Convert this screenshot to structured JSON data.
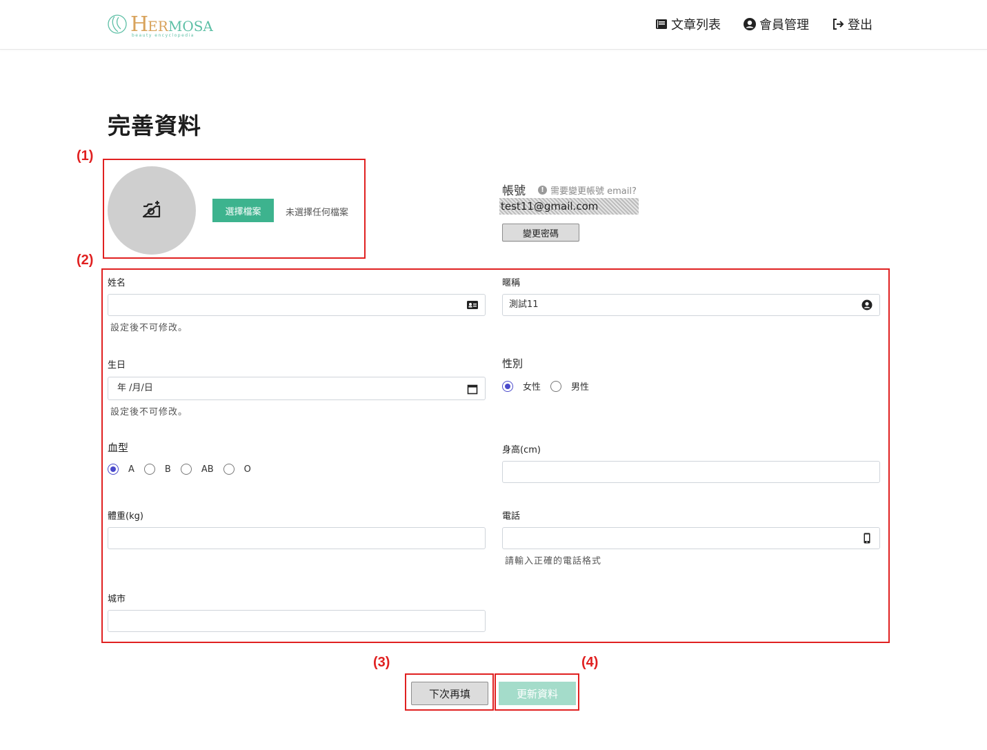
{
  "brand": {
    "logo_h": "H",
    "logo_er": "ER",
    "logo_mosa": "MOSA",
    "logo_sub": "beauty encyclopedia",
    "primary_color": "#3db38e",
    "accent_color": "#d8a35c"
  },
  "nav": {
    "articles": {
      "label": "文章列表",
      "icon": "book-icon"
    },
    "members": {
      "label": "會員管理",
      "icon": "user-circle-icon"
    },
    "logout": {
      "label": "登出",
      "icon": "sign-out-icon"
    }
  },
  "page": {
    "title": "完善資料"
  },
  "annotations": {
    "a1": "(1)",
    "a2": "(2)",
    "a3": "(3)",
    "a4": "(4)"
  },
  "avatar": {
    "icon": "camera-plus-icon",
    "choose_file": "選擇檔案",
    "no_file": "未選擇任何檔案"
  },
  "account": {
    "label": "帳號",
    "hint": "需要變更帳號 email?",
    "email": "test11@gmail.com",
    "change_password": "變更密碼"
  },
  "form": {
    "name": {
      "label": "姓名",
      "value": "",
      "helper": "設定後不可修改。",
      "icon": "id-card-icon"
    },
    "nickname": {
      "label": "暱稱",
      "value": "測試11",
      "icon": "user-circle-icon"
    },
    "birthday": {
      "label": "生日",
      "value": "年 /月/日",
      "helper": "設定後不可修改。",
      "icon": "calendar-icon"
    },
    "gender": {
      "label": "性別",
      "options": [
        "女性",
        "男性"
      ],
      "selected": "女性"
    },
    "blood_type": {
      "label": "血型",
      "options": [
        "A",
        "B",
        "AB",
        "O"
      ],
      "selected": "A"
    },
    "height": {
      "label": "身高(cm)",
      "value": ""
    },
    "weight": {
      "label": "體重(kg)",
      "value": ""
    },
    "phone": {
      "label": "電話",
      "value": "",
      "helper": "請輸入正確的電話格式",
      "icon": "mobile-icon"
    },
    "city": {
      "label": "城市",
      "value": ""
    }
  },
  "actions": {
    "later": "下次再填",
    "update": "更新資料"
  }
}
